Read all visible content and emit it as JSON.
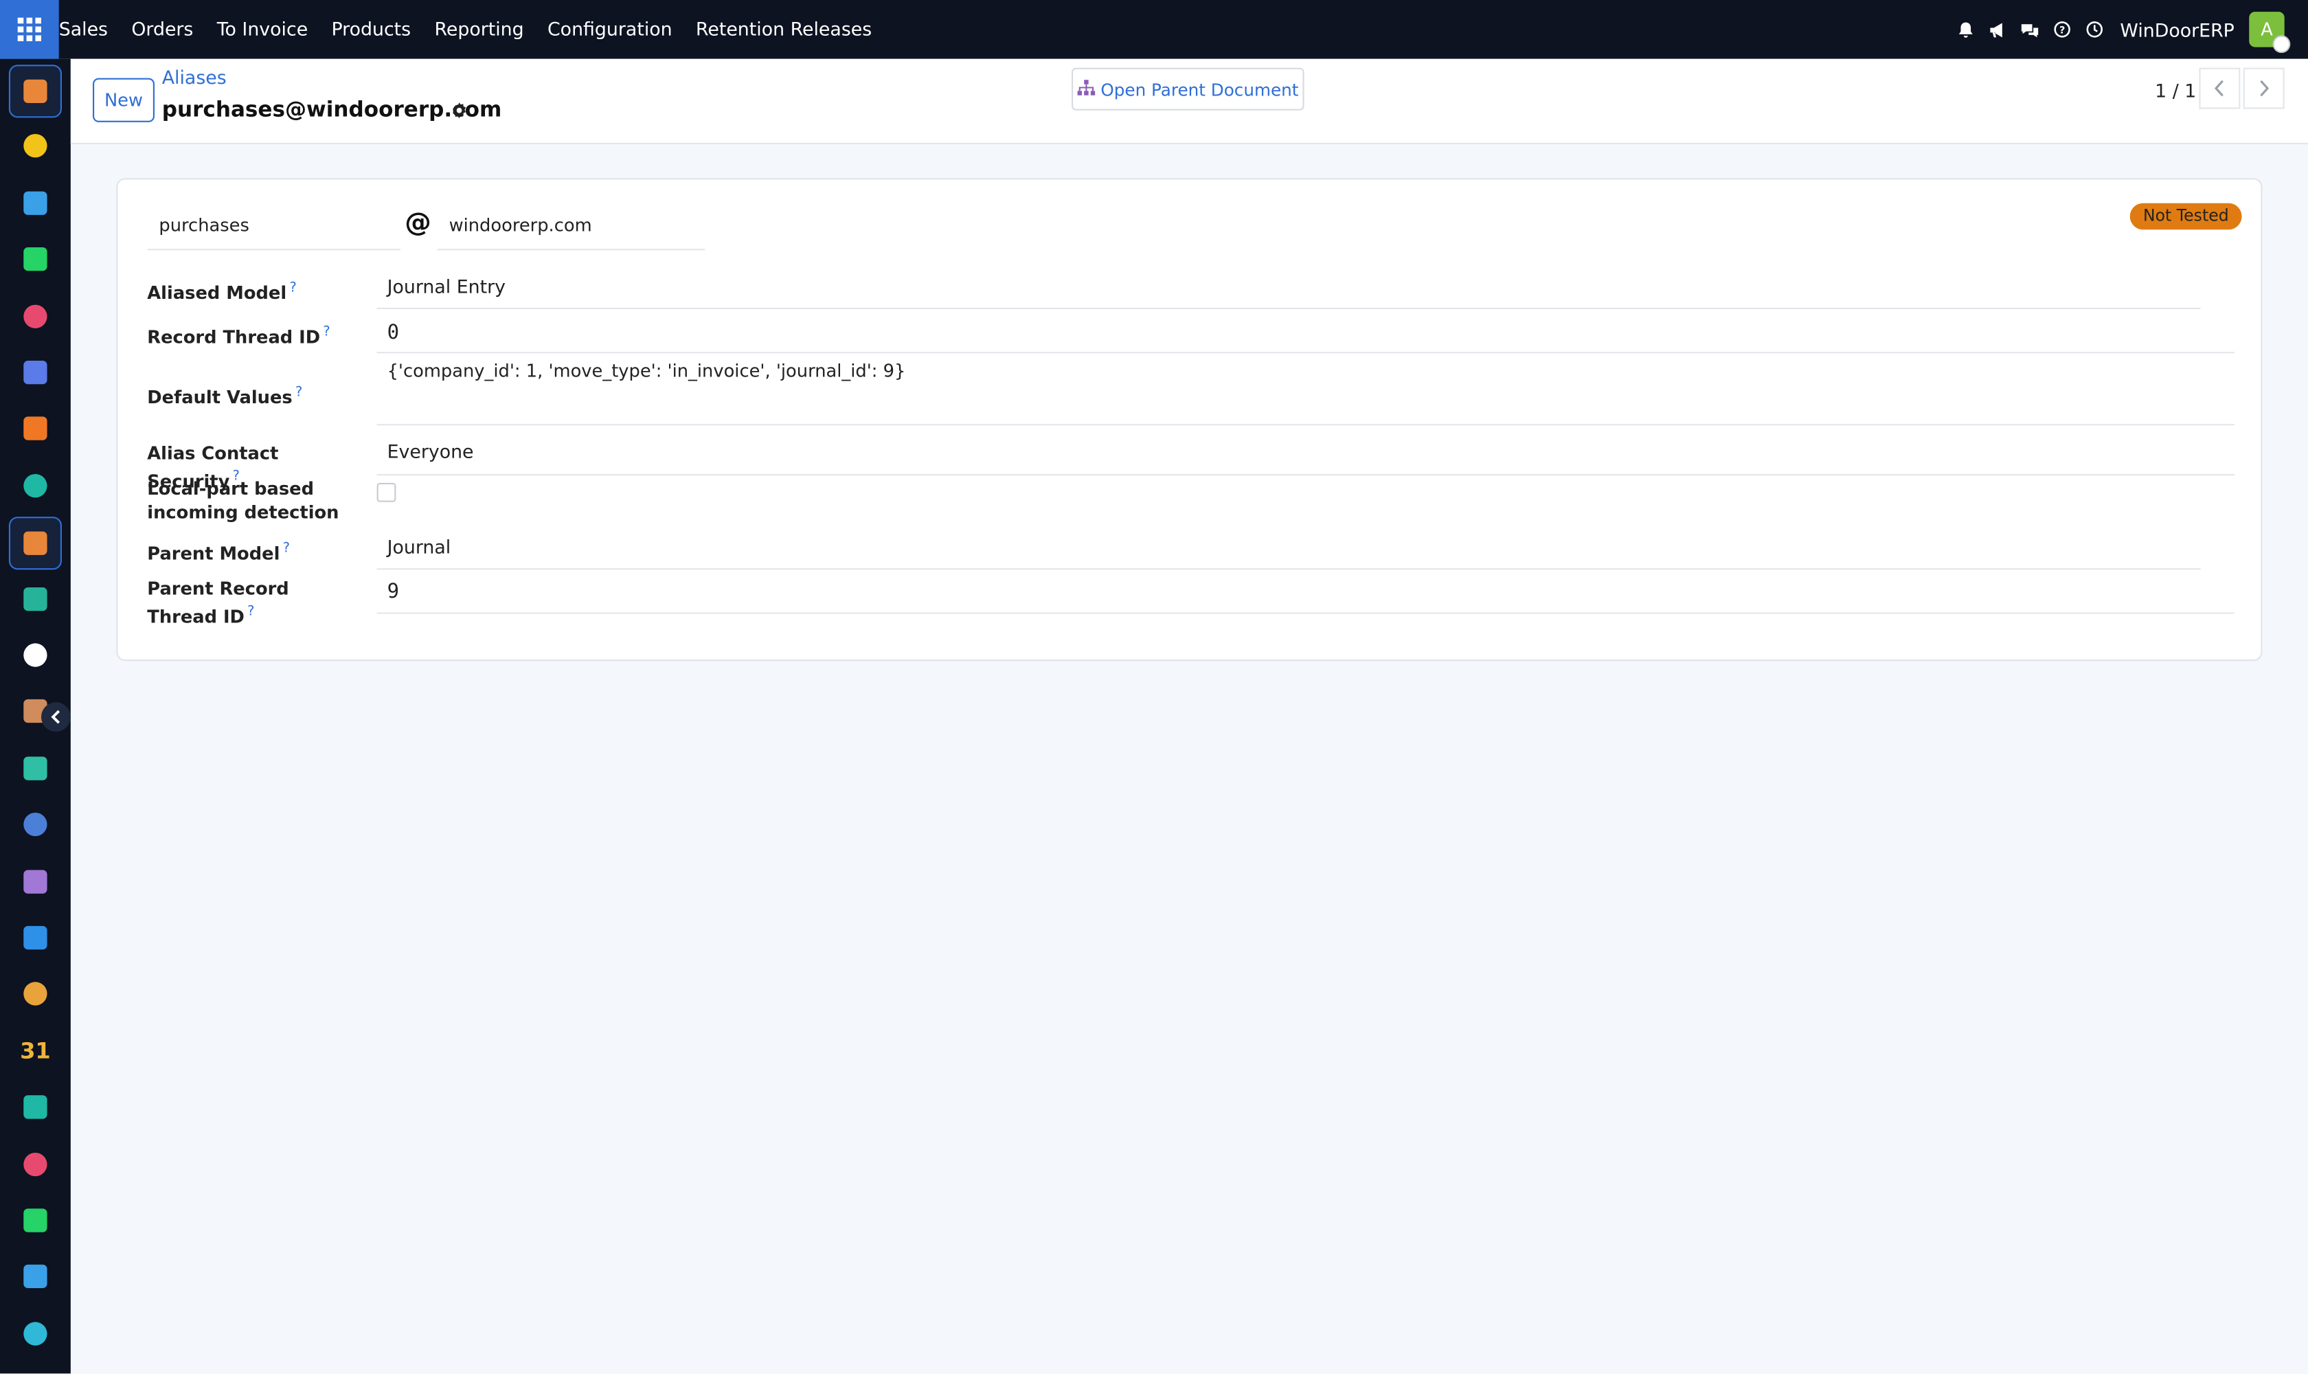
{
  "topbar": {
    "menu": [
      "Sales",
      "Orders",
      "To Invoice",
      "Products",
      "Reporting",
      "Configuration",
      "Retention Releases"
    ],
    "company": "WinDoorERP",
    "avatar_initial": "A"
  },
  "appbar": {
    "apps": [
      {
        "name": "reporting-app",
        "color": "#e8873a",
        "active": true
      },
      {
        "name": "send-app",
        "color": "#f2c318"
      },
      {
        "name": "dashboard-app",
        "color": "#3aa0e8"
      },
      {
        "name": "whatsapp-app",
        "color": "#25d366"
      },
      {
        "name": "dashboards-app",
        "color": "#e84a6f"
      },
      {
        "name": "mail-app",
        "color": "#5a7be8"
      },
      {
        "name": "chat-app",
        "color": "#f07824"
      },
      {
        "name": "transfer-app",
        "color": "#1fb8a4"
      },
      {
        "name": "sales-app",
        "color": "#e8873a",
        "active": true
      },
      {
        "name": "contacts-app",
        "color": "#27b39a"
      },
      {
        "name": "inventory-app",
        "color": "#ffffff"
      },
      {
        "name": "helpdesk-app",
        "color": "#d08c5c"
      },
      {
        "name": "project-app",
        "color": "#2fbfa4"
      },
      {
        "name": "knowledge-app",
        "color": "#4b7fd8"
      },
      {
        "name": "manufacturing-app",
        "color": "#a178d6"
      },
      {
        "name": "invoicing-app",
        "color": "#2f90e8"
      },
      {
        "name": "employees-app",
        "color": "#e8a43a"
      },
      {
        "name": "calendar-app",
        "color": "#f0b43a",
        "text": "31"
      },
      {
        "name": "sign-app",
        "color": "#1fb8a4"
      },
      {
        "name": "dashboards-app-2",
        "color": "#e84a6f"
      },
      {
        "name": "whatsapp-app-2",
        "color": "#25d366"
      },
      {
        "name": "dashboard-app-2",
        "color": "#3aa0e8"
      },
      {
        "name": "studio-app",
        "color": "#2fb8d8"
      }
    ]
  },
  "control": {
    "new_label": "New",
    "breadcrumb": "Aliases",
    "record_title": "purchases@windoorerp.com",
    "open_parent_label": "Open Parent Document",
    "pager": "1 / 1"
  },
  "form": {
    "alias_name": "purchases",
    "at": "@",
    "alias_domain": "windoorerp.com",
    "status": "Not Tested",
    "fields": {
      "aliased_model": {
        "label": "Aliased Model",
        "value": "Journal Entry"
      },
      "record_thread_id": {
        "label": "Record Thread ID",
        "value": "0"
      },
      "default_values": {
        "label": "Default Values",
        "value": "{'company_id': 1, 'move_type': 'in_invoice', 'journal_id': 9}"
      },
      "alias_contact_security": {
        "label": "Alias Contact Security",
        "value": "Everyone"
      },
      "local_part_detection": {
        "label": "Local-part based incoming detection"
      },
      "parent_model": {
        "label": "Parent Model",
        "value": "Journal"
      },
      "parent_record_thread_id": {
        "label": "Parent Record Thread ID",
        "value": "9"
      }
    },
    "help_mark": "?"
  }
}
